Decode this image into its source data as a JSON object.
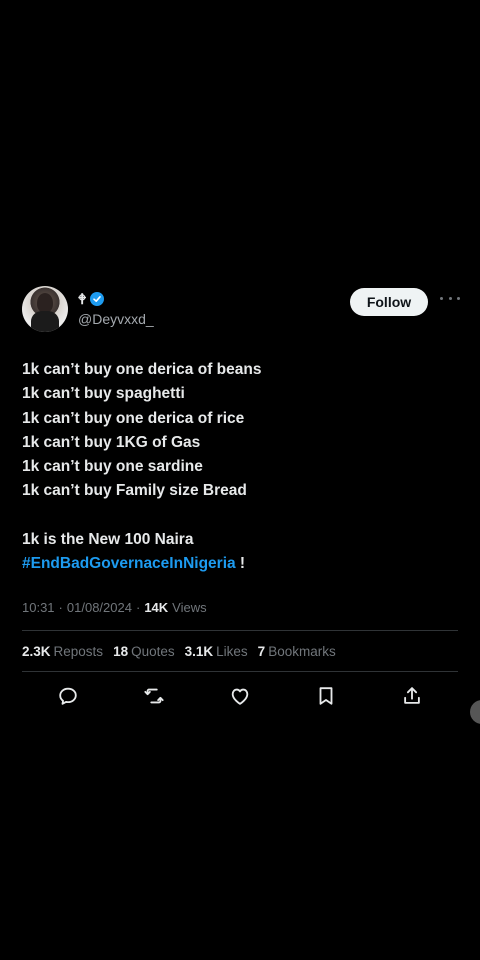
{
  "tweet": {
    "author": {
      "display_name": "🕈",
      "verified": true,
      "handle": "@Deyvxxd_",
      "avatar": "person-avatar"
    },
    "follow_label": "Follow",
    "more_icon": "ellipsis-icon",
    "lines": [
      "1k can’t buy one derica of beans",
      "1k can’t buy spaghetti",
      "1k can’t buy one derica of rice",
      "1k can’t buy 1KG of Gas",
      "1k can’t buy one sardine",
      "1k can’t buy Family size Bread"
    ],
    "closing_line": "1k is the New 100 Naira",
    "hashtag": "#EndBadGovernaceInNigeria",
    "hashtag_suffix": " !",
    "time": "10:31",
    "date": "01/08/2024",
    "views_count": "14K",
    "views_label": "Views",
    "stats": [
      {
        "count": "2.3K",
        "label": "Reposts"
      },
      {
        "count": "18",
        "label": "Quotes"
      },
      {
        "count": "3.1K",
        "label": "Likes"
      },
      {
        "count": "7",
        "label": "Bookmarks"
      }
    ],
    "actions": [
      "reply-icon",
      "repost-icon",
      "like-icon",
      "bookmark-icon",
      "share-icon"
    ]
  },
  "colors": {
    "background": "#000000",
    "text": "#e7e9ea",
    "muted": "#71767b",
    "accent": "#1d9bf0",
    "divider": "#2f3336"
  }
}
